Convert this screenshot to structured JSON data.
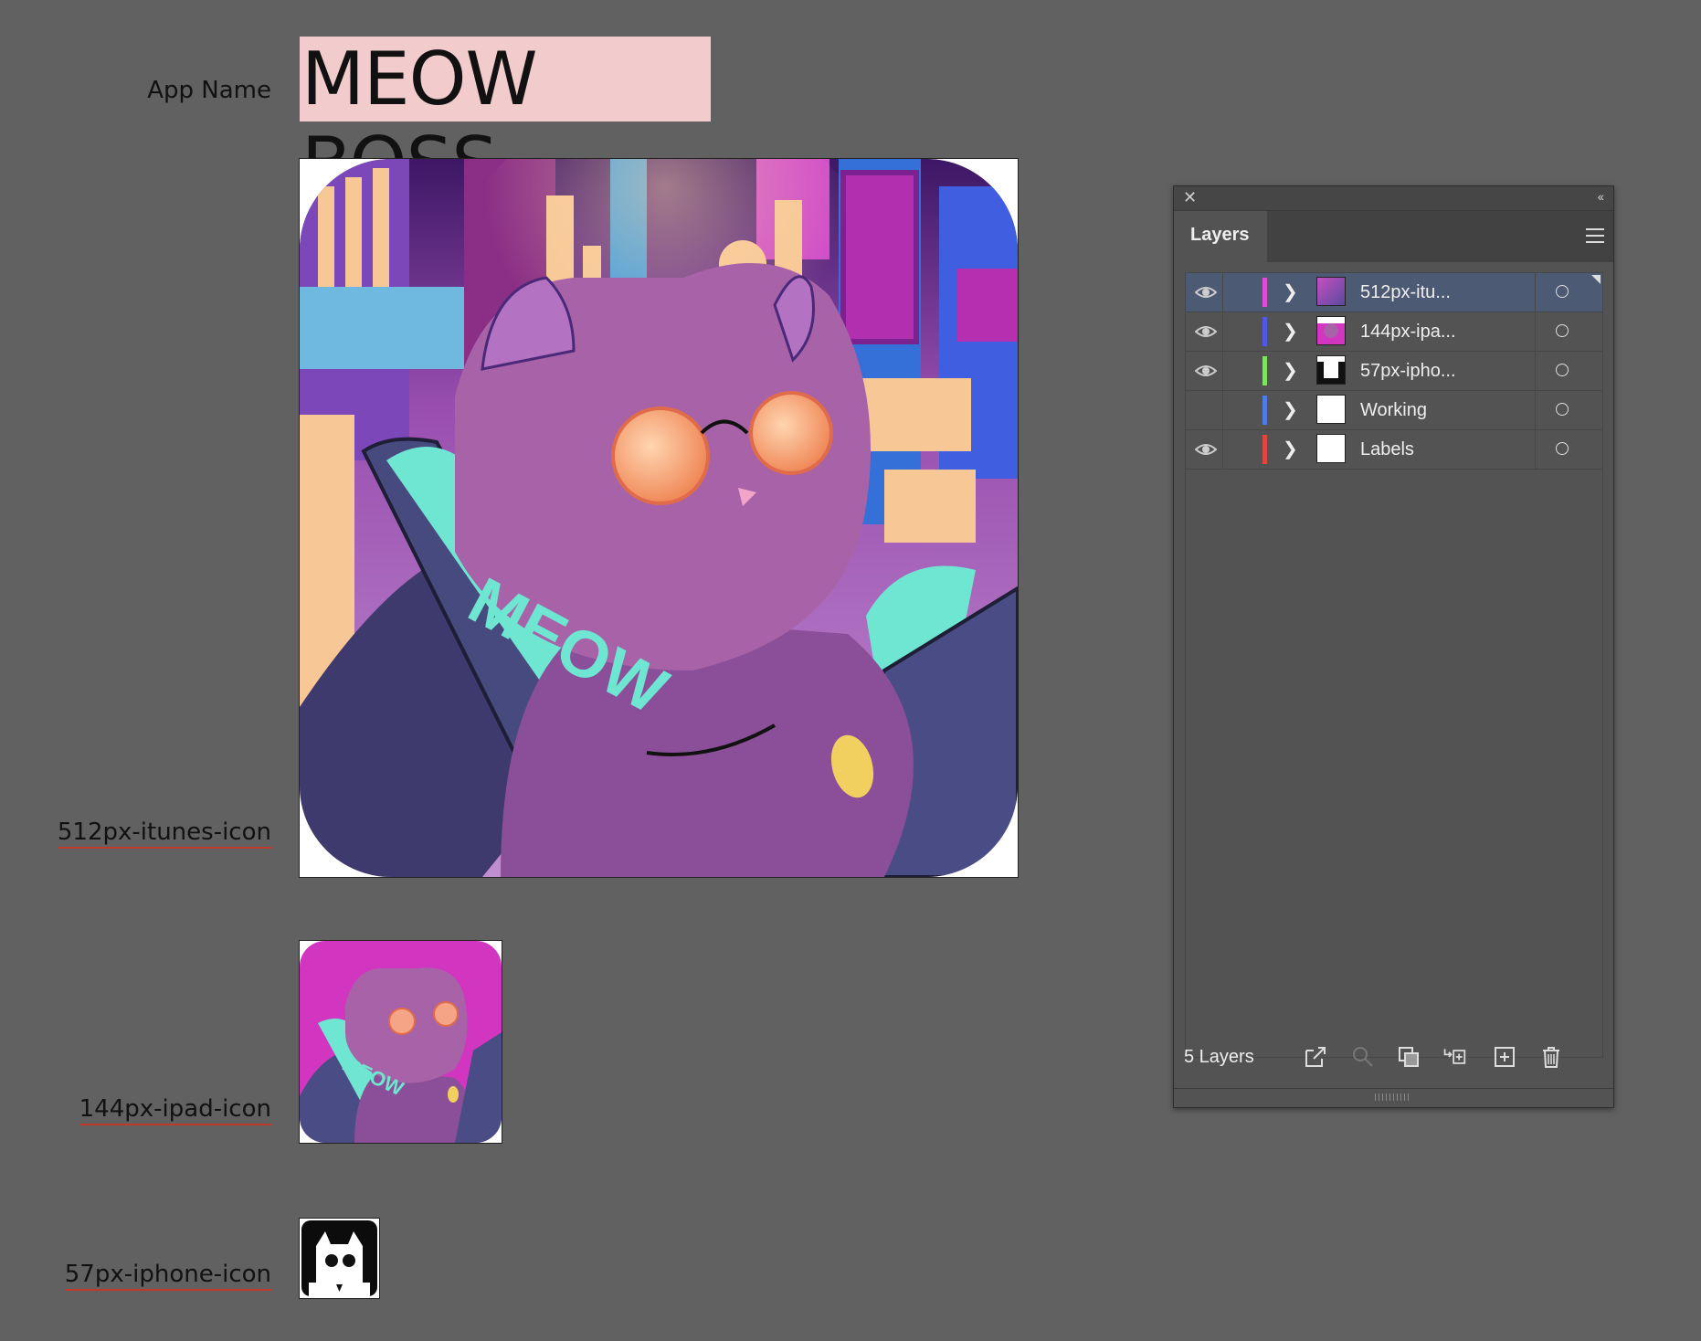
{
  "document": {
    "app_name_label": "App Name",
    "app_name_value": "MEOW BOSS",
    "artboard_labels": {
      "itunes": "512px-itunes-icon",
      "ipad": "144px-ipad-icon",
      "iphone": "57px-iphone-icon"
    },
    "icon_artwork_text": "MEOW"
  },
  "layers_panel": {
    "tab_label": "Layers",
    "close_icon": "close-icon",
    "collapse_icon": "collapse-icon",
    "menu_icon": "panel-menu-icon",
    "layers": [
      {
        "name": "512px-itu...",
        "visible": true,
        "color": "#e04bd9",
        "selected": true
      },
      {
        "name": "144px-ipa...",
        "visible": true,
        "color": "#4f59e6",
        "selected": false
      },
      {
        "name": "57px-ipho...",
        "visible": true,
        "color": "#7ee35f",
        "selected": false
      },
      {
        "name": "Working",
        "visible": false,
        "color": "#4f7be6",
        "selected": false
      },
      {
        "name": "Labels",
        "visible": true,
        "color": "#e0453f",
        "selected": false
      }
    ],
    "footer_count": "5 Layers",
    "footer_icons": [
      "export-icon",
      "locate-object-icon",
      "clipping-mask-icon",
      "new-sublayer-icon",
      "new-layer-icon",
      "delete-icon"
    ]
  }
}
